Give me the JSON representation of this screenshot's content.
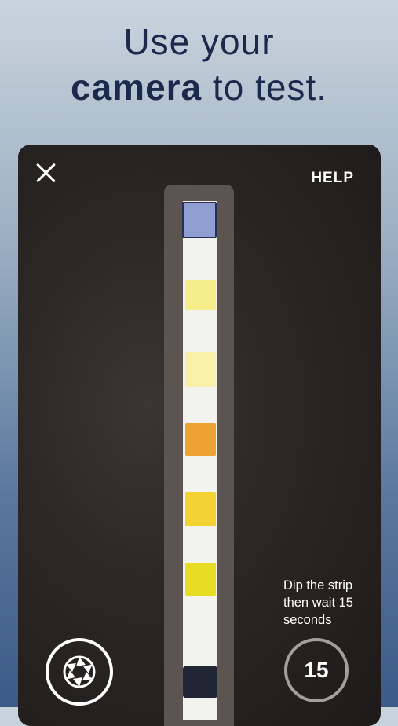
{
  "headline": {
    "line1": "Use your",
    "bold": "camera",
    "rest": " to test."
  },
  "camera": {
    "help_label": "HELP",
    "instruction": "Dip the strip then wait 15 seconds",
    "timer_value": "15"
  },
  "icons": {
    "close": "close-icon",
    "shutter": "aperture-icon"
  },
  "colors": {
    "headline_text": "#1b2a4c",
    "pads": [
      "#8f9dd0",
      "#f5ec8a",
      "#f8f0a8",
      "#eea233",
      "#f3d233",
      "#e8dd22"
    ]
  }
}
